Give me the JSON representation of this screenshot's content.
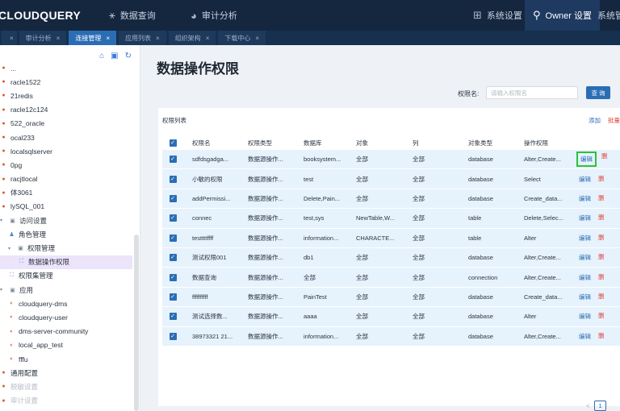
{
  "app": {
    "logo": "CLOUDQUERY",
    "nav": [
      {
        "icon": "share-nodes-icon",
        "label": "数据查询"
      },
      {
        "icon": "chart-circle-icon",
        "label": "审计分析"
      }
    ],
    "right_nav": [
      {
        "icon": "sitemap-icon",
        "label": "系统设置"
      },
      {
        "icon": "user-tree-icon",
        "label": "Owner 设置"
      },
      {
        "label": "系统管"
      }
    ]
  },
  "tabs": [
    {
      "label": "",
      "close": "×"
    },
    {
      "label": "审计分析",
      "close": "×"
    },
    {
      "label": "连接管理",
      "close": "×",
      "active": true
    },
    {
      "label": "应用列表",
      "close": "×"
    },
    {
      "label": "组织架构",
      "close": "×"
    },
    {
      "label": "下载中心",
      "close": "×"
    }
  ],
  "sidebar": {
    "tools": [
      "home-icon",
      "window-icon",
      "refresh-icon"
    ],
    "items": [
      {
        "label": "...",
        "level": 0,
        "icon": "db"
      },
      {
        "label": "racle1522",
        "level": 0,
        "icon": "db"
      },
      {
        "label": "21redis",
        "level": 0,
        "icon": "db"
      },
      {
        "label": "racle12c124",
        "level": 0,
        "icon": "db"
      },
      {
        "label": "522_oracle",
        "level": 0,
        "icon": "db"
      },
      {
        "label": "ocal233",
        "level": 0,
        "icon": "db"
      },
      {
        "label": "localsqlserver",
        "level": 0,
        "icon": "db"
      },
      {
        "label": "0pg",
        "level": 0,
        "icon": "db"
      },
      {
        "label": "racjtlocal",
        "level": 0,
        "icon": "db"
      },
      {
        "label": "体3061",
        "level": 0,
        "icon": "db"
      },
      {
        "label": "lySQL_001",
        "level": 0,
        "icon": "db"
      },
      {
        "label": "访问设置",
        "level": 0,
        "icon": "folder"
      },
      {
        "label": "角色管理",
        "level": 1,
        "icon": "role"
      },
      {
        "label": "权限管理",
        "level": 1,
        "icon": "folder"
      },
      {
        "label": "数据操作权限",
        "level": 2,
        "icon": "perm",
        "selected": true
      },
      {
        "label": "权限集管理",
        "level": 1,
        "icon": "perm"
      },
      {
        "label": "应用",
        "level": 0,
        "icon": "folder"
      },
      {
        "label": "cloudquery-dms",
        "level": 1,
        "icon": "app"
      },
      {
        "label": "cloudquery-user",
        "level": 1,
        "icon": "app"
      },
      {
        "label": "dms-server-community",
        "level": 1,
        "icon": "app"
      },
      {
        "label": "local_app_test",
        "level": 1,
        "icon": "app"
      },
      {
        "label": "fffu",
        "level": 1,
        "icon": "app"
      },
      {
        "label": "通用配置",
        "level": 0,
        "icon": "db"
      },
      {
        "label": "脱敏设置",
        "level": 0,
        "icon": "db",
        "faded": true
      },
      {
        "label": "审计设置",
        "level": 0,
        "icon": "db",
        "faded": true
      }
    ]
  },
  "main": {
    "title": "数据操作权限",
    "filter_label": "权限名:",
    "filter_placeholder": "请输入权限名",
    "query_button": "查 询",
    "panel_title": "权限列表",
    "add_link": "添加",
    "delete_link": "批量",
    "columns": [
      "权限名",
      "权限类型",
      "数据库",
      "对象",
      "列",
      "对象类型",
      "操作权限"
    ],
    "rows": [
      {
        "name": "sdfdsgadga...",
        "type": "数据源操作...",
        "db": "booksystem...",
        "obj": "全部",
        "col": "全部",
        "otype": "database",
        "perm": "Alter,Create...",
        "highlight": true
      },
      {
        "name": "小敏的权限",
        "type": "数据源操作...",
        "db": "test",
        "obj": "全部",
        "col": "全部",
        "otype": "database",
        "perm": "Select"
      },
      {
        "name": "addPermissi...",
        "type": "数据源操作...",
        "db": "Delete,Pain...",
        "obj": "全部",
        "col": "全部",
        "otype": "database",
        "perm": "Create_data..."
      },
      {
        "name": "connec",
        "type": "数据源操作...",
        "db": "test,sys",
        "obj": "NewTable,W...",
        "col": "全部",
        "otype": "table",
        "perm": "Delete,Selec..."
      },
      {
        "name": "testtttffff",
        "type": "数据源操作...",
        "db": "information...",
        "obj": "CHARACTE...",
        "col": "全部",
        "otype": "table",
        "perm": "Alter"
      },
      {
        "name": "测试权限001",
        "type": "数据源操作...",
        "db": "db1",
        "obj": "全部",
        "col": "全部",
        "otype": "database",
        "perm": "Alter,Create..."
      },
      {
        "name": "数据查询",
        "type": "数据源操作...",
        "db": "全部",
        "obj": "全部",
        "col": "全部",
        "otype": "connection",
        "perm": "Alter,Create..."
      },
      {
        "name": "ffffffffff",
        "type": "数据源操作...",
        "db": "PainTest",
        "obj": "全部",
        "col": "全部",
        "otype": "database",
        "perm": "Create_data..."
      },
      {
        "name": "测试选择数...",
        "type": "数据源操作...",
        "db": "aaaa",
        "obj": "全部",
        "col": "全部",
        "otype": "database",
        "perm": "Alter"
      },
      {
        "name": "38973321 21...",
        "type": "数据源操作...",
        "db": "information...",
        "obj": "全部",
        "col": "全部",
        "otype": "database",
        "perm": "Alter,Create..."
      }
    ],
    "row_edit": "编辑",
    "row_delete": "删",
    "pagination": {
      "prev": "<",
      "current": "1"
    }
  }
}
